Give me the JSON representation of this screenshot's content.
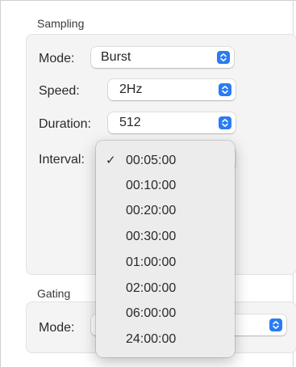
{
  "sampling": {
    "section_title": "Sampling",
    "mode": {
      "label": "Mode:",
      "value": "Burst"
    },
    "speed": {
      "label": "Speed:",
      "value": "2Hz"
    },
    "duration": {
      "label": "Duration:",
      "value": "512"
    },
    "interval": {
      "label": "Interval:",
      "selected": "00:05:00",
      "options": [
        "00:05:00",
        "00:10:00",
        "00:20:00",
        "00:30:00",
        "01:00:00",
        "02:00:00",
        "06:00:00",
        "24:00:00"
      ],
      "check_glyph": "✓"
    }
  },
  "gating": {
    "section_title": "Gating",
    "mode": {
      "label": "Mode:",
      "value": ""
    }
  },
  "colors": {
    "accent": "#2a7bf5",
    "group_bg": "#f4f4f4",
    "menu_bg": "#ececec"
  },
  "icons": {
    "stepper": "up-down-chevron-icon",
    "check": "checkmark-icon"
  }
}
